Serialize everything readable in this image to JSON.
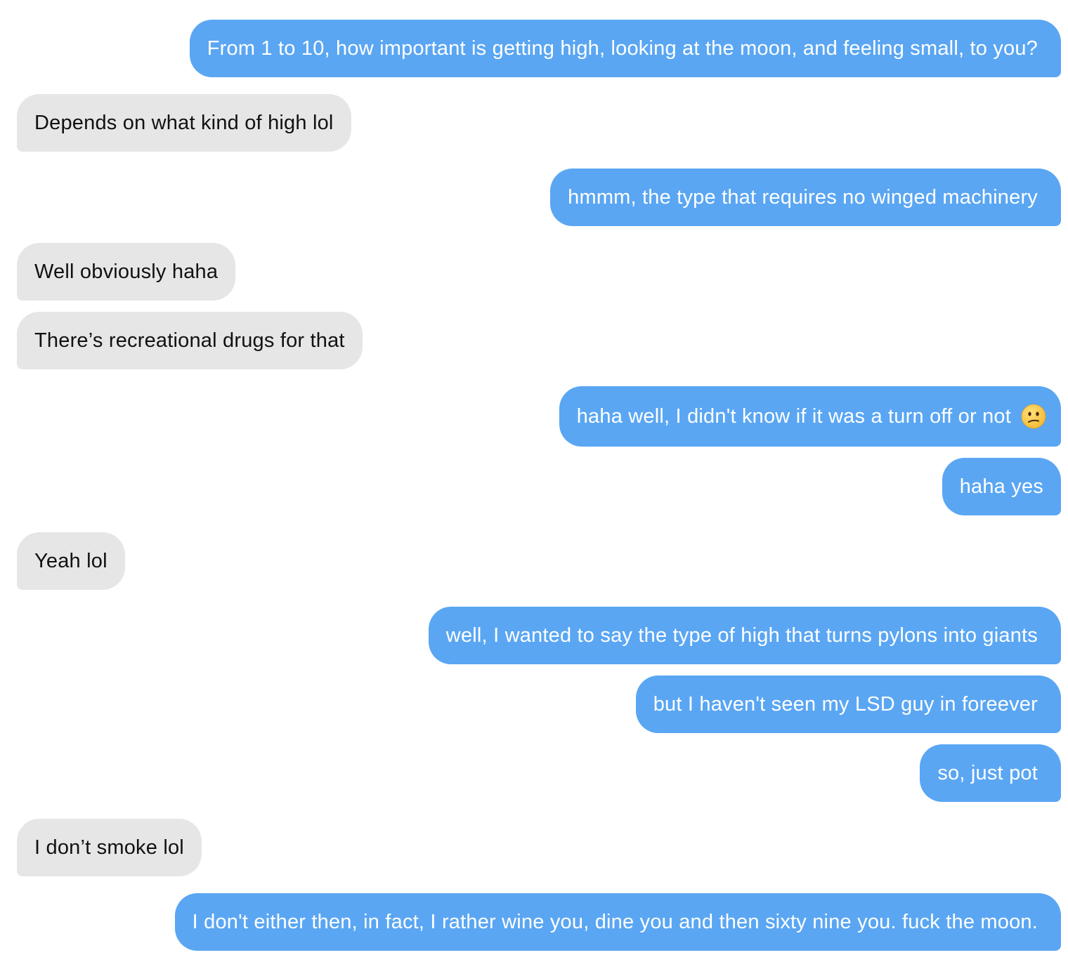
{
  "messages": [
    {
      "side": "sent",
      "text": "From 1 to 10, how important is getting high, looking at the moon, and feeling small, to you?"
    },
    {
      "side": "received",
      "text": "Depends on what kind of high lol"
    },
    {
      "side": "sent",
      "text": "hmmm, the type that requires no winged machinery"
    },
    {
      "side": "received",
      "text": "Well obviously haha"
    },
    {
      "side": "received",
      "text": "There’s recreational drugs for that"
    },
    {
      "side": "sent",
      "text": "haha well, I didn't know if it was a turn off or not",
      "emoji": "confused-face-icon"
    },
    {
      "side": "sent",
      "text": "haha yes"
    },
    {
      "side": "received",
      "text": "Yeah lol"
    },
    {
      "side": "sent",
      "text": "well, I wanted to say the type of high that turns pylons into giants"
    },
    {
      "side": "sent",
      "text": "but I haven't seen my LSD guy in foreever"
    },
    {
      "side": "sent",
      "text": "so, just pot"
    },
    {
      "side": "received",
      "text": "I don’t smoke lol"
    },
    {
      "side": "sent",
      "text": "I don't either then, in fact, I rather wine you, dine you and then sixty nine you. fuck the moon."
    }
  ],
  "colors": {
    "sent_bubble": "#5aa6f3",
    "received_bubble": "#e6e6e6",
    "sent_text": "#ffffff",
    "received_text": "#111111"
  }
}
